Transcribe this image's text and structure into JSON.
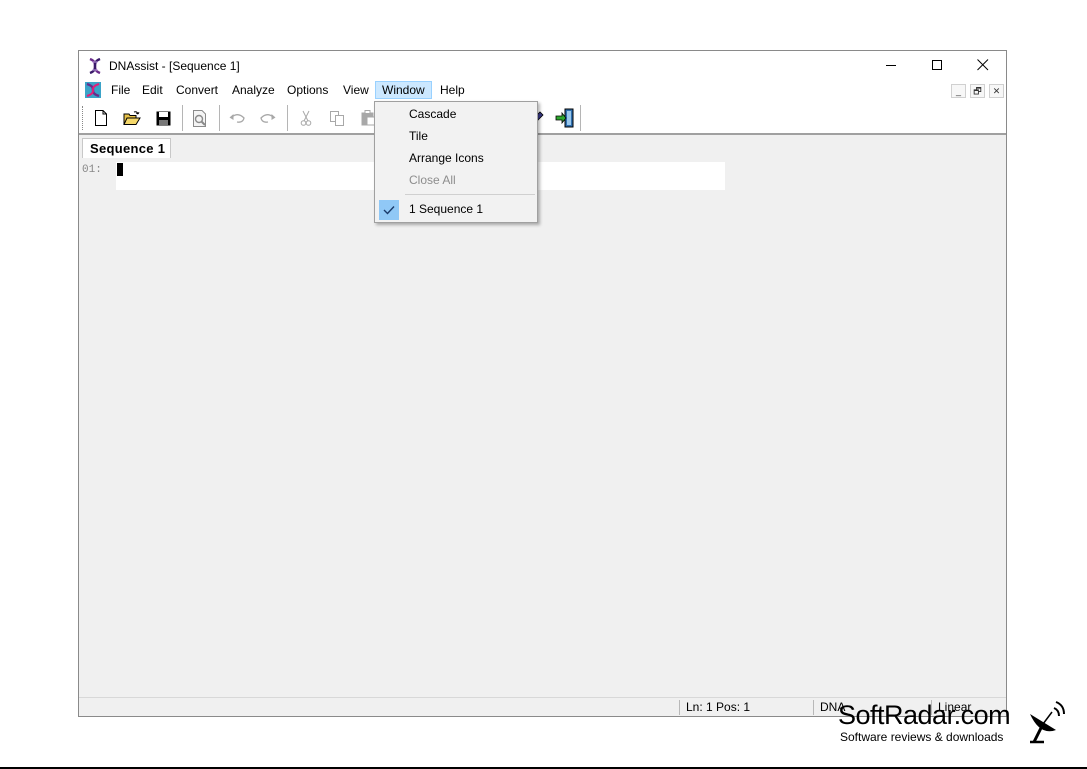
{
  "window": {
    "title": "DNAssist - [Sequence 1]",
    "icons": {
      "app": "dna-helix-icon",
      "minimize": "minimize-icon",
      "maximize": "maximize-icon",
      "close": "close-icon"
    }
  },
  "menubar": {
    "items": [
      {
        "label": "File"
      },
      {
        "label": "Edit"
      },
      {
        "label": "Convert"
      },
      {
        "label": "Analyze"
      },
      {
        "label": "Options"
      },
      {
        "label": "View"
      },
      {
        "label": "Window",
        "open": true
      },
      {
        "label": "Help"
      }
    ],
    "mdi_controls": [
      "_",
      "🗗",
      "✕"
    ]
  },
  "toolbar": {
    "buttons": [
      "new-file",
      "open-folder",
      "save",
      "print-preview",
      "undo",
      "redo",
      "cut",
      "copy",
      "paste",
      "edit-sequence",
      "exit"
    ]
  },
  "document": {
    "tab_label": "Sequence 1",
    "line_number": "01:",
    "sequence_text": ""
  },
  "window_menu": {
    "items": [
      {
        "label": "Cascade",
        "enabled": true
      },
      {
        "label": "Tile",
        "enabled": true
      },
      {
        "label": "Arrange Icons",
        "enabled": true
      },
      {
        "label": "Close All",
        "enabled": false
      },
      {
        "label": "1 Sequence 1",
        "enabled": true,
        "checked": true
      }
    ]
  },
  "statusbar": {
    "position": "Ln: 1  Pos: 1",
    "type": "DNA",
    "topology": "Linear"
  },
  "watermark": {
    "brand": "SoftRadar.com",
    "tagline": "Software reviews & downloads"
  }
}
